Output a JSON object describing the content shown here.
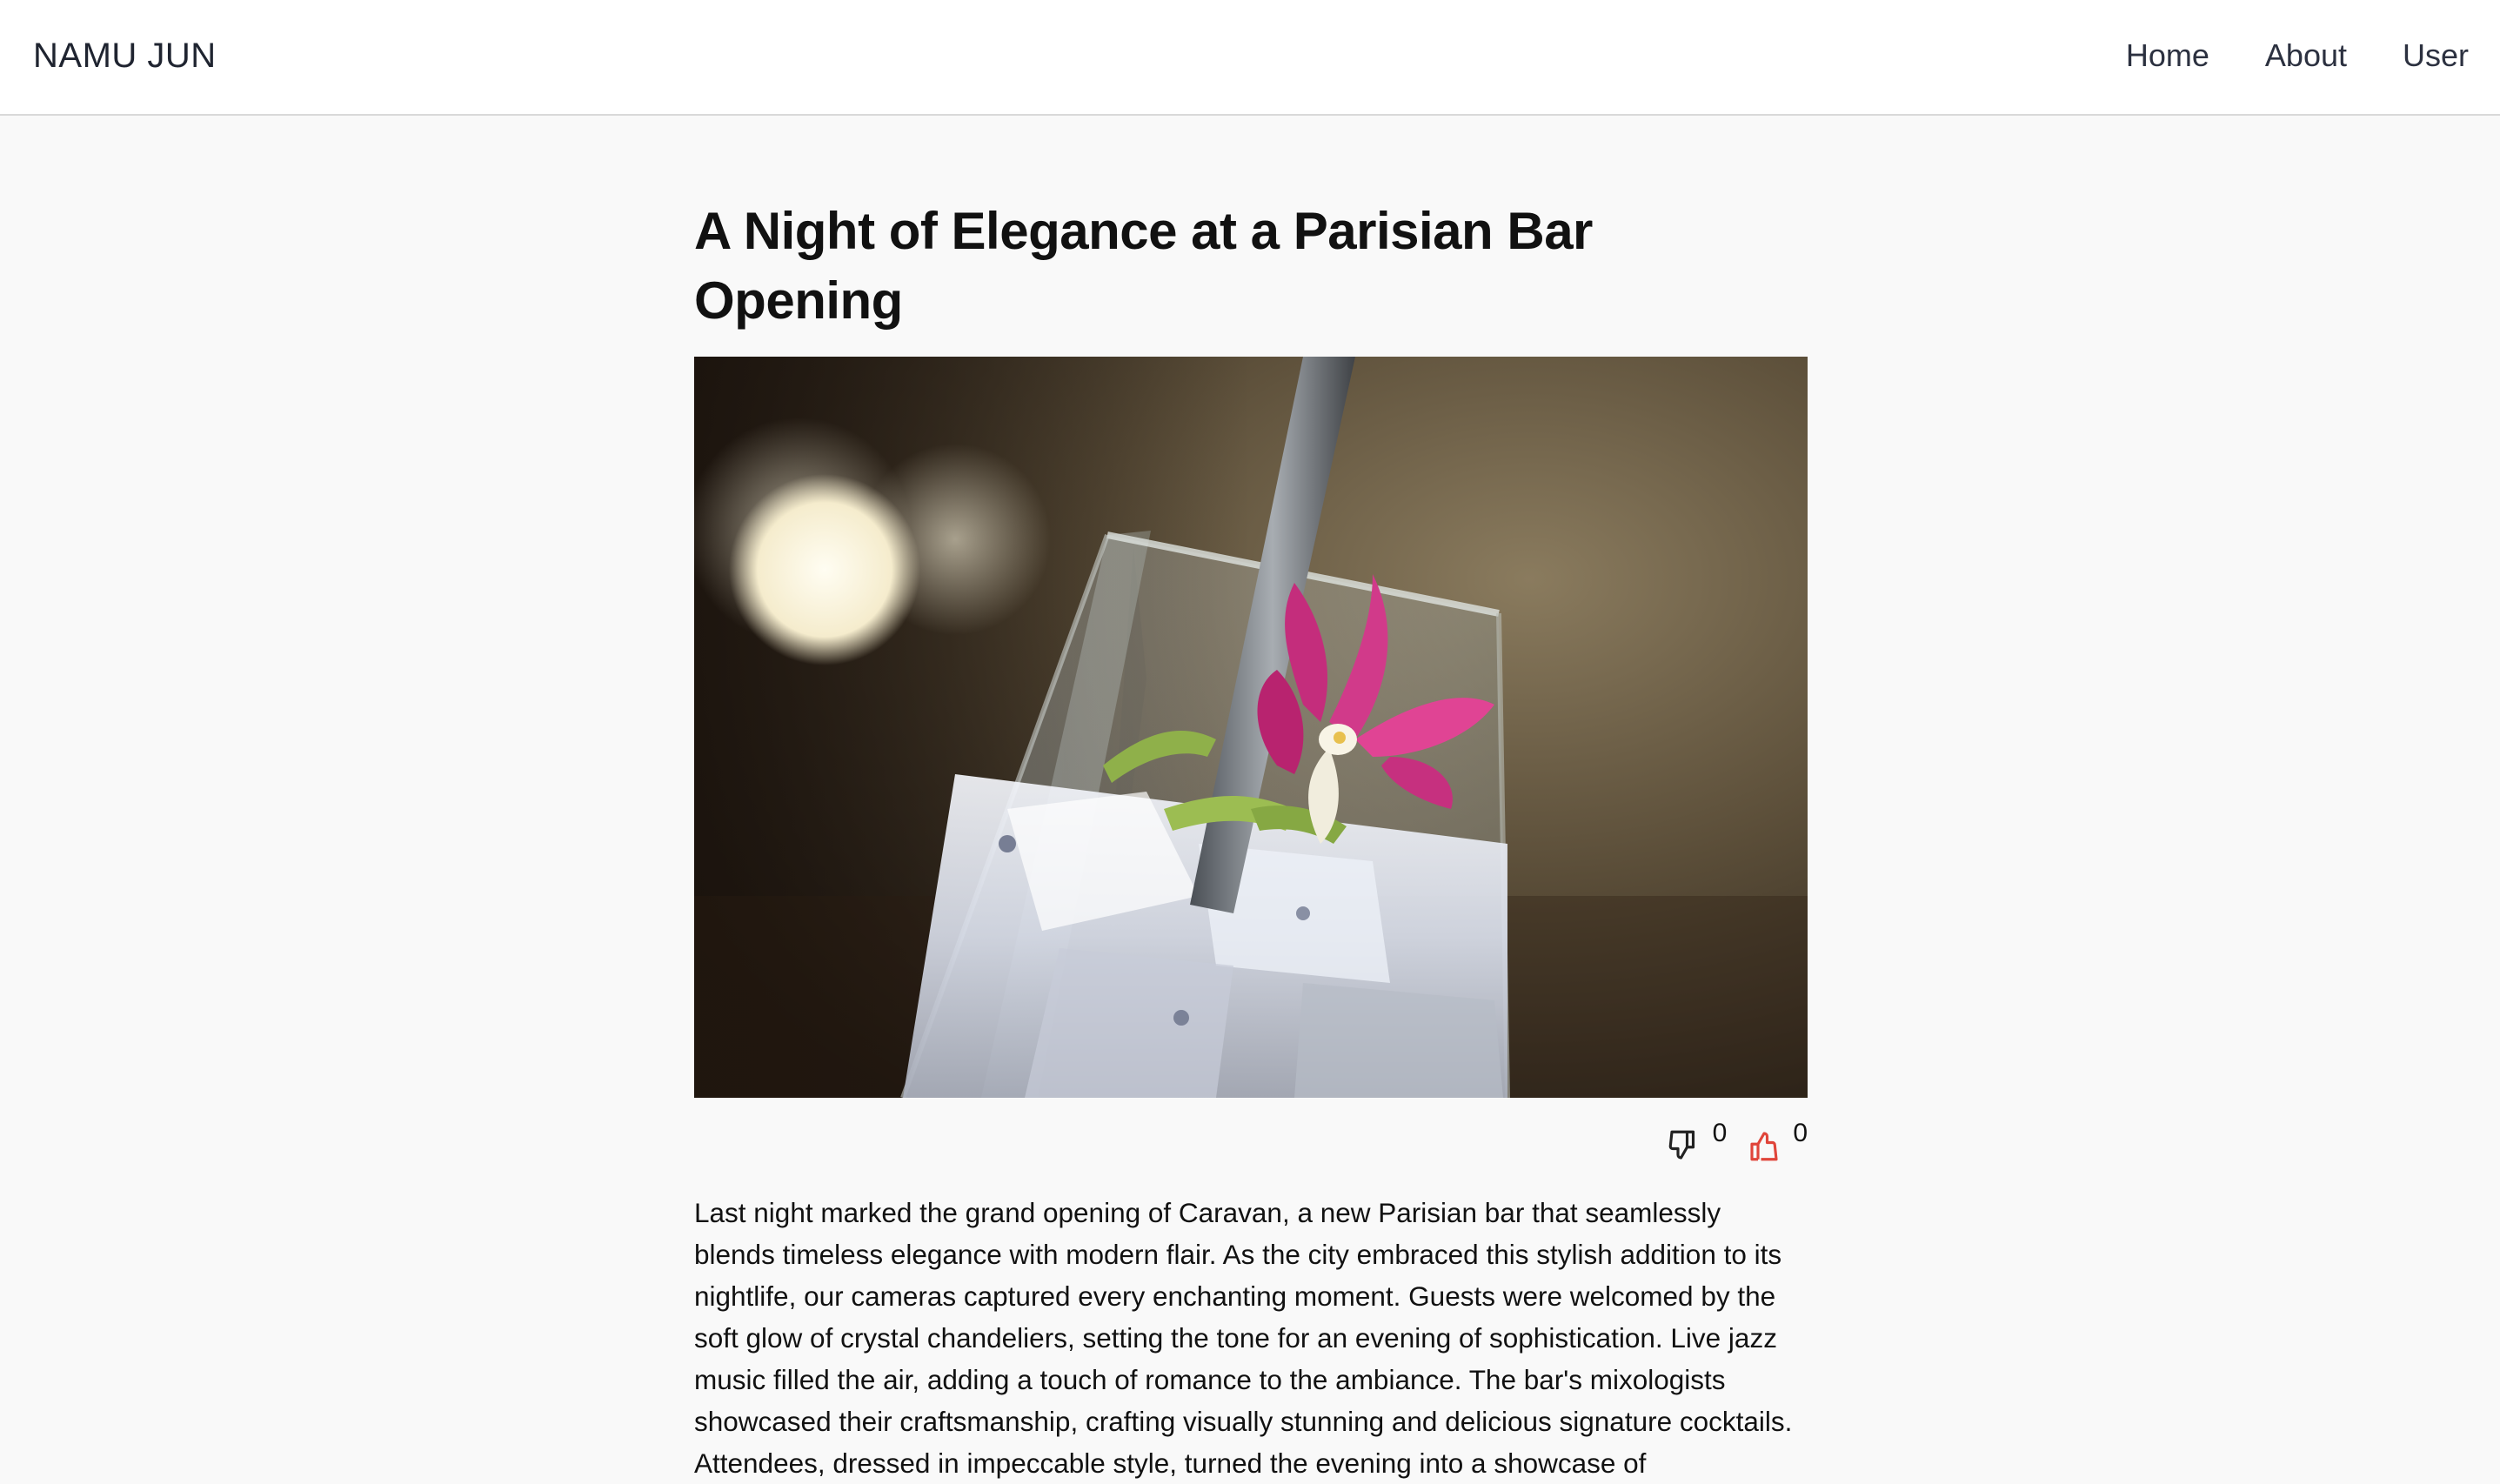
{
  "header": {
    "brand": "NAMU JUN",
    "nav": [
      "Home",
      "About",
      "User"
    ]
  },
  "article": {
    "title": "A Night of Elegance at a Parisian Bar Opening",
    "image_alt": "Cocktail glass with ice, lime peel and an orchid garnish",
    "reactions": {
      "dislike_count": "0",
      "like_count": "0"
    },
    "body": "Last night marked the grand opening of Caravan, a new Parisian bar that seamlessly blends timeless elegance with modern flair. As the city embraced this stylish addition to its nightlife, our cameras captured every enchanting moment. Guests were welcomed by the soft glow of crystal chandeliers, setting the tone for an evening of sophistication. Live jazz music filled the air, adding a touch of romance to the ambiance. The bar's mixologists showcased their craftsmanship, crafting visually stunning and delicious signature cocktails. Attendees, dressed in impeccable style, turned the evening into a showcase of"
  },
  "colors": {
    "like_icon": "#e0453a",
    "dislike_icon": "#222222",
    "background": "#f9f9f9"
  },
  "icons": [
    "thumbs-down-icon",
    "thumbs-up-icon"
  ]
}
